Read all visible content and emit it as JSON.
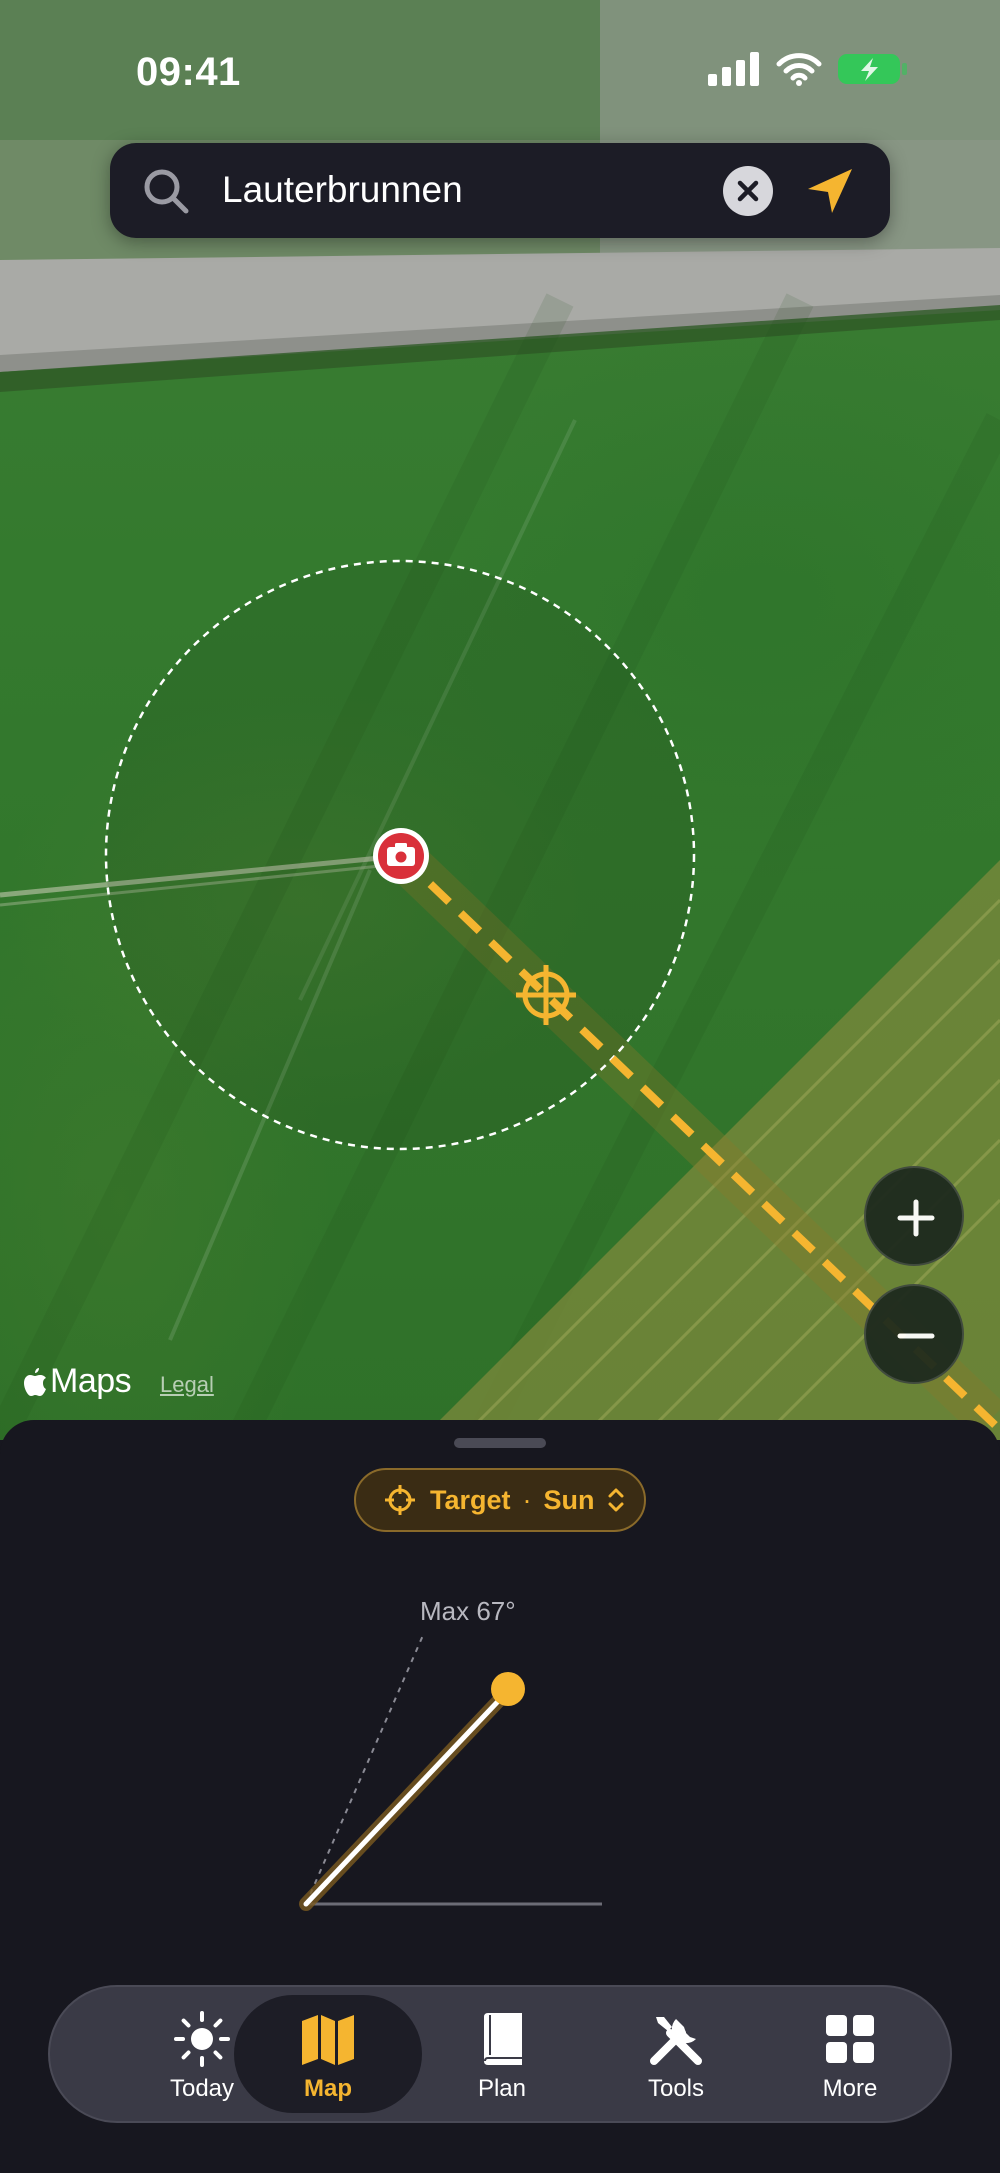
{
  "status_bar": {
    "time": "09:41"
  },
  "search": {
    "query": "Lauterbrunnen"
  },
  "map": {
    "attribution": "Maps",
    "legal_link": "Legal",
    "zoom_in": "+",
    "zoom_out": "−"
  },
  "sheet": {
    "target_label": "Target",
    "target_separator": "·",
    "target_value": "Sun",
    "max_altitude_label": "Max 67°"
  },
  "tabs": [
    {
      "label": "Today",
      "icon": "sun-icon",
      "active": false
    },
    {
      "label": "Map",
      "icon": "map-icon",
      "active": true
    },
    {
      "label": "Plan",
      "icon": "book-icon",
      "active": false
    },
    {
      "label": "Tools",
      "icon": "tools-icon",
      "active": false
    },
    {
      "label": "More",
      "icon": "grid-icon",
      "active": false
    }
  ],
  "colors": {
    "accent": "#F5B530",
    "sheet_background": "#17171F",
    "camera_pin": "#D9303A",
    "battery_green": "#34C759"
  }
}
